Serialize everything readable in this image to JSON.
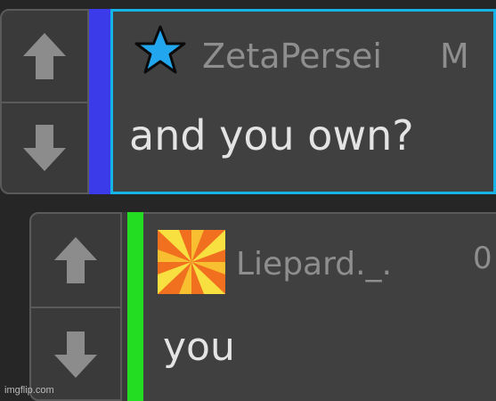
{
  "comments": [
    {
      "username": "ZetaPersei",
      "badge": "M",
      "message": "and you own?",
      "accent_color": "#3b3bea",
      "highlight_color": "#16b4e6",
      "avatar_icon": "star-icon",
      "avatar_color": "#22a6ee"
    },
    {
      "username": "Liepard._.",
      "badge": "0",
      "message": "you",
      "accent_color": "#22dd22",
      "avatar_icon": "pinwheel-icon",
      "avatar_colors": [
        "#f07020",
        "#f8e040"
      ]
    }
  ],
  "watermark": "imgflip.com"
}
